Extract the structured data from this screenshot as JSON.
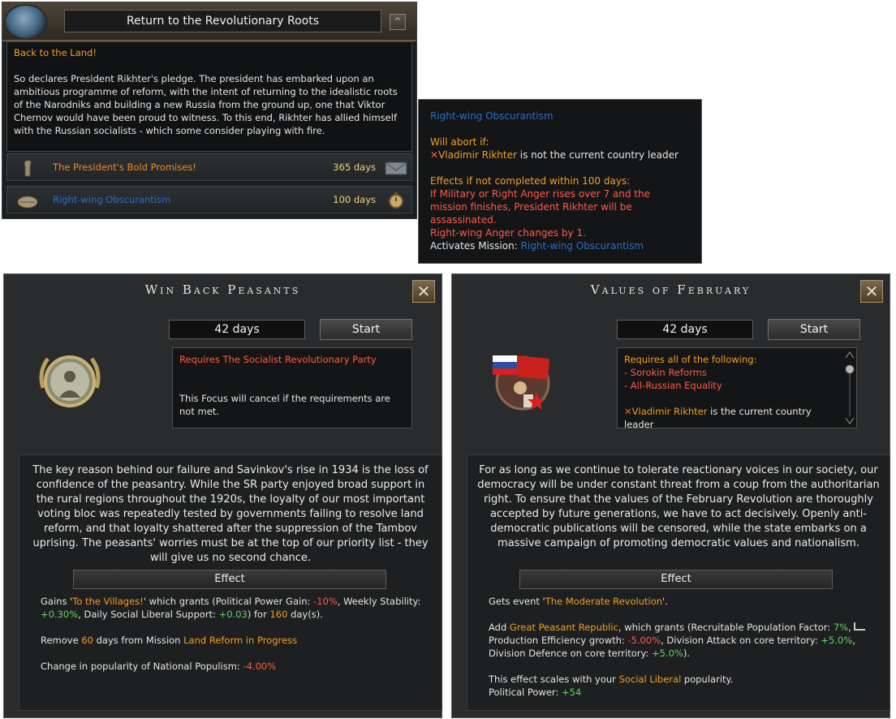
{
  "mission_panel": {
    "title": "Return to the Revolutionary Roots",
    "collapse_symbol": "^",
    "desc_heading": "Back to the Land!",
    "desc_text": "So declares President Rikhter's pledge. The president has embarked upon an ambitious programme of reform, with the intent of returning to the idealistic roots of the Narodniks and building a new Russia from the ground up, one that Viktor Chernov would have been proud to witness. To this end, Rikhter has allied himself with the Russian socialists - which some consider playing with fire.",
    "rows": [
      {
        "name": "The President's Bold Promises!",
        "days": "365 days",
        "name_color": "#f08a20",
        "icon": "hand-fist-icon",
        "status_icon": "envelope-icon"
      },
      {
        "name": "Right-wing Obscurantism",
        "days": "100 days",
        "name_color": "#2d6cc0",
        "icon": "handshake-icon",
        "status_icon": "stopwatch-icon"
      }
    ]
  },
  "tooltip": {
    "title": "Right-wing Obscurantism",
    "abort_label": "Will abort if:",
    "abort_leader": "Vladimir Rikhter",
    "abort_condition": " is not the current country leader",
    "effects_label": "Effects if not completed within 100 days:",
    "effect_line1": "If Military or Right Anger rises over 7 and the mission finishes, President Rikhter will be assassinated.",
    "effect_line2": "Right-wing Anger changes by 1.",
    "activates_label": "Activates Mission: ",
    "activates_value": "Right-wing Obscurantism"
  },
  "focus_left": {
    "title": "Win Back Peasants",
    "days": "42 days",
    "start_label": "Start",
    "req_title": "Requires The Socialist Revolutionary Party",
    "req_note": "This Focus will cancel if the requirements are not met.",
    "story": "The key reason behind our failure and Savinkov's rise in 1934 is the loss of confidence of the peasantry. While the SR party enjoyed broad support in the rural regions throughout the 1920s, the loyalty of our most important voting bloc was repeatedly tested by governments failing to resolve land reform, and that loyalty shattered after the suppression of the Tambov uprising. The peasants' worries must be at the top of our priority list - they will give us no second chance.",
    "effect_header": "Effect",
    "e1_a": "Gains '",
    "e1_name": "To the Villages!",
    "e1_b": "' which grants (Political Power Gain: ",
    "e1_pp": "-10%",
    "e1_c": ", Weekly Stability: ",
    "e1_stab": "+0.30%",
    "e1_d": ", Daily Social Liberal Support: ",
    "e1_sup": "+0.03",
    "e1_e": ") for ",
    "e1_days": "160",
    "e1_f": " day(s).",
    "e2_a": "Remove ",
    "e2_num": "60",
    "e2_b": " days from Mission ",
    "e2_mission": "Land Reform in Progress",
    "e3_a": "Change in popularity of National Populism: ",
    "e3_val": "-4.00%"
  },
  "focus_right": {
    "title": "Values of February",
    "days": "42 days",
    "start_label": "Start",
    "req_title": "Requires all of the following:",
    "req_item1": "- Sorokin Reforms",
    "req_item2": "- All-Russian Equality",
    "req_leader": "Vladimir Rikhter",
    "req_leader_text": " is the current country leader",
    "story": "For as long as we continue to tolerate reactionary voices in our society, our democracy will be under constant threat from a coup from the authoritarian right. To ensure that the values of the February Revolution are thoroughly accepted by future generations, we have to act decisively. Openly anti-democratic publications will be censored, while the state embarks on a massive campaign of promoting democratic values and nationalism.",
    "effect_header": "Effect",
    "e1_a": "Gets event '",
    "e1_event": "The Moderate Revolution",
    "e1_b": "'.",
    "e2_a": "Add ",
    "e2_name": "Great Peasant Republic",
    "e2_b": ", which grants (Recruitable Population Factor: ",
    "e2_rpf": "7%",
    "e2_c": ", ",
    "e2_d": "Production Efficiency growth: ",
    "e2_peg": "-5.00%",
    "e2_e": ", Division Attack on core territory: ",
    "e2_att": "+5.0%",
    "e2_f": ", Division Defence on core territory: ",
    "e2_def": "+5.0%",
    "e2_g": ").",
    "e3_a": "This effect scales with your ",
    "e3_party": "Social Liberal",
    "e3_b": " popularity.",
    "e4_a": "Political Power: ",
    "e4_val": "+54"
  }
}
